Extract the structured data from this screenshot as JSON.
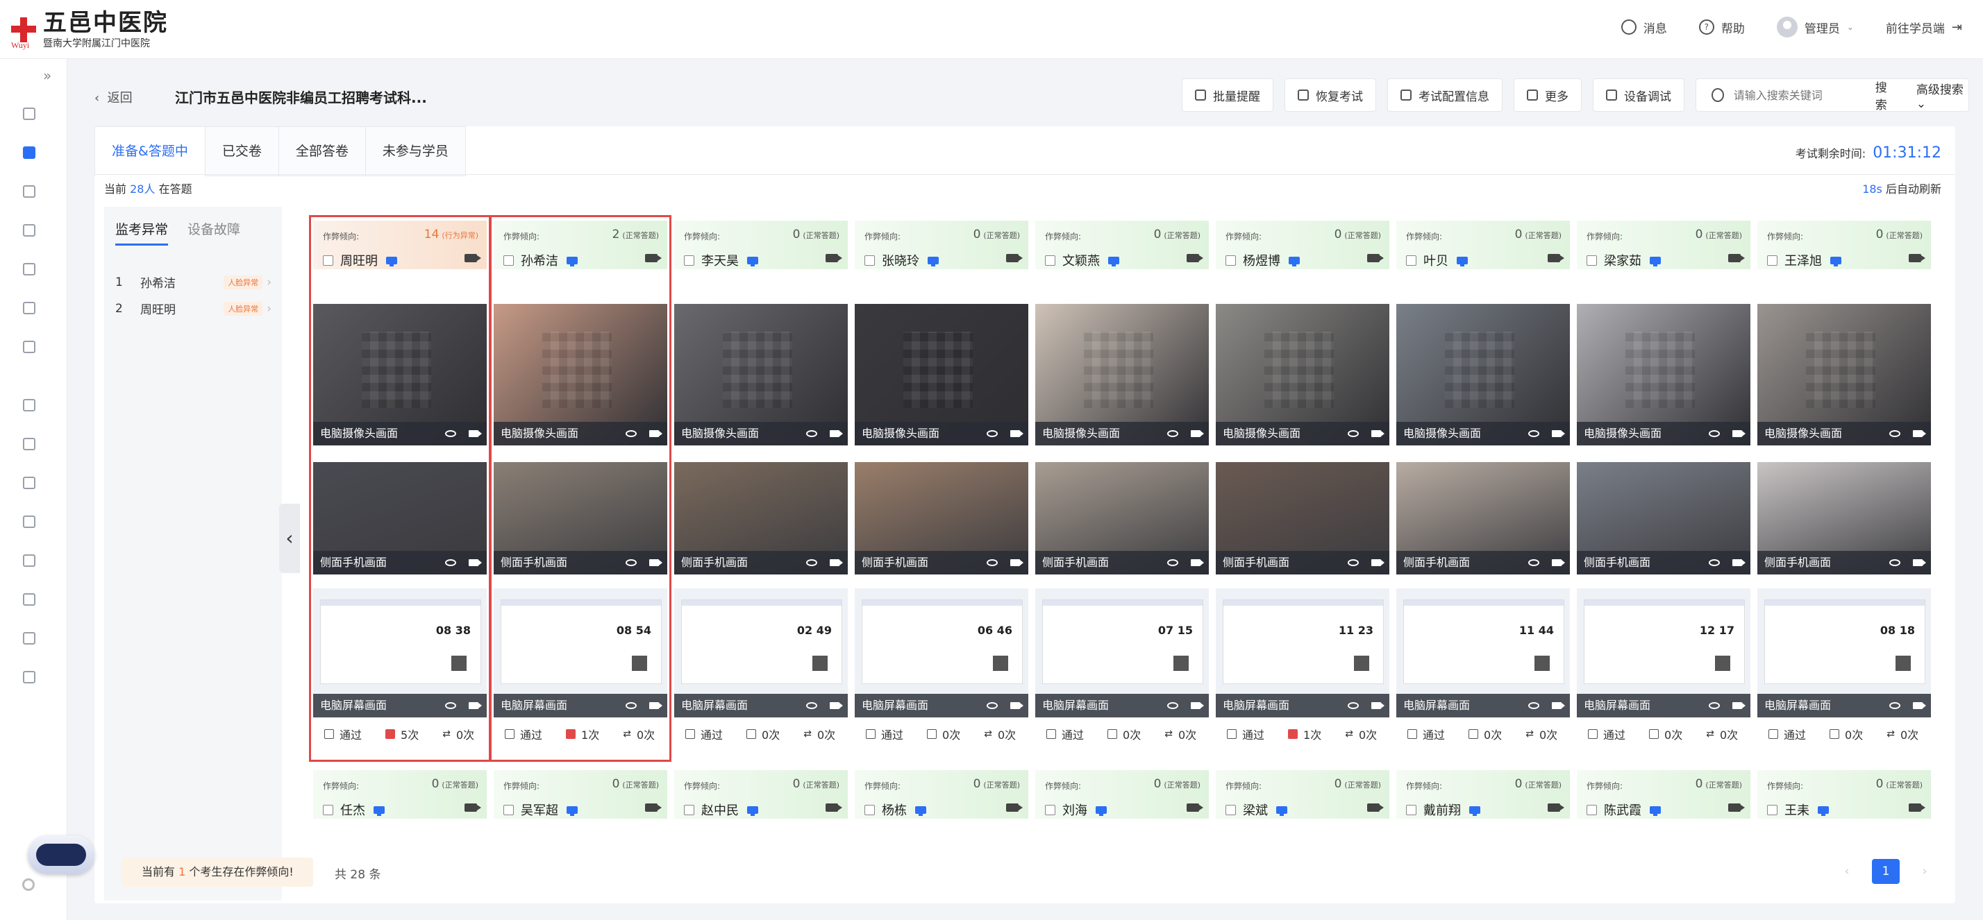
{
  "brand": {
    "logo_name": "五邑中医院",
    "logo_caption": "暨南大学附属江门中医院",
    "logo_sub": "Wuyi"
  },
  "topbar": {
    "messages": "消息",
    "help": "帮助",
    "user": "管理员",
    "student_portal": "前往学员端"
  },
  "subheader": {
    "back": "返回",
    "exam_title": "江门市五邑中医院非编员工招聘考试科...",
    "buttons": [
      "批量提醒",
      "恢复考试",
      "考试配置信息",
      "更多",
      "设备调试"
    ],
    "search_placeholder": "请输入搜索关键词",
    "search_btn": "搜索",
    "advanced_search": "高级搜索"
  },
  "tabs": [
    "准备&答题中",
    "已交卷",
    "全部答卷",
    "未参与学员"
  ],
  "timer": {
    "label": "考试剩余时间:",
    "value": "01:31:12"
  },
  "summary": {
    "prefix": "当前",
    "count": "28人",
    "suffix": "在答题"
  },
  "refresh": {
    "seconds": "18s",
    "suffix": "后自动刷新"
  },
  "anomaly_panel": {
    "tabs": [
      "监考异常",
      "设备故障"
    ],
    "items": [
      {
        "num": "1",
        "name": "孙希洁",
        "tag": "人脸异常"
      },
      {
        "num": "2",
        "name": "周旺明",
        "tag": "人脸异常"
      }
    ]
  },
  "card_labels": {
    "tendency": "作弊倾向:",
    "camera": "电脑摄像头画面",
    "phone": "侧面手机画面",
    "screen": "电脑屏幕画面",
    "pass": "通过"
  },
  "candidates_row1": [
    {
      "name": "周旺明",
      "count": "14",
      "note": "(行为异常)",
      "warn": true,
      "face": "5次",
      "switch": "0次",
      "face_red": true,
      "clock": "08 38"
    },
    {
      "name": "孙希洁",
      "count": "2",
      "note": "(正常答题)",
      "warn": false,
      "face": "1次",
      "switch": "0次",
      "face_red": true,
      "clock": "08 54"
    },
    {
      "name": "李天昊",
      "count": "0",
      "note": "(正常答题)",
      "warn": false,
      "face": "0次",
      "switch": "0次",
      "face_red": false,
      "clock": "02 49"
    },
    {
      "name": "张晓玲",
      "count": "0",
      "note": "(正常答题)",
      "warn": false,
      "face": "0次",
      "switch": "0次",
      "face_red": false,
      "clock": "06 46"
    },
    {
      "name": "文颖燕",
      "count": "0",
      "note": "(正常答题)",
      "warn": false,
      "face": "0次",
      "switch": "0次",
      "face_red": false,
      "clock": "07 15"
    },
    {
      "name": "杨煜博",
      "count": "0",
      "note": "(正常答题)",
      "warn": false,
      "face": "1次",
      "switch": "0次",
      "face_red": true,
      "clock": "11 23"
    },
    {
      "name": "叶贝",
      "count": "0",
      "note": "(正常答题)",
      "warn": false,
      "face": "0次",
      "switch": "0次",
      "face_red": false,
      "clock": "11 44"
    },
    {
      "name": "梁家茹",
      "count": "0",
      "note": "(正常答题)",
      "warn": false,
      "face": "0次",
      "switch": "0次",
      "face_red": false,
      "clock": "12 17"
    },
    {
      "name": "王泽旭",
      "count": "0",
      "note": "(正常答题)",
      "warn": false,
      "face": "0次",
      "switch": "0次",
      "face_red": false,
      "clock": "08 18"
    }
  ],
  "candidates_row2": [
    {
      "name": "任杰",
      "count": "0",
      "note": "(正常答题)"
    },
    {
      "name": "吴军超",
      "count": "0",
      "note": "(正常答题)"
    },
    {
      "name": "赵中民",
      "count": "0",
      "note": "(正常答题)"
    },
    {
      "name": "杨栋",
      "count": "0",
      "note": "(正常答题)"
    },
    {
      "name": "刘海",
      "count": "0",
      "note": "(正常答题)"
    },
    {
      "name": "梁斌",
      "count": "0",
      "note": "(正常答题)"
    },
    {
      "name": "戴前翔",
      "count": "0",
      "note": "(正常答题)"
    },
    {
      "name": "陈武霞",
      "count": "0",
      "note": "(正常答题)"
    },
    {
      "name": "王耒",
      "count": "0",
      "note": "(正常答题)"
    }
  ],
  "footer": {
    "alert_prefix": "当前有",
    "alert_count": "1",
    "alert_suffix": "个考生存在作弊倾向!",
    "total": "共 28 条",
    "page": "1"
  },
  "colors": {
    "accent": "#2b6ff5",
    "warn": "#e8773c",
    "alert_red": "#e14848"
  }
}
